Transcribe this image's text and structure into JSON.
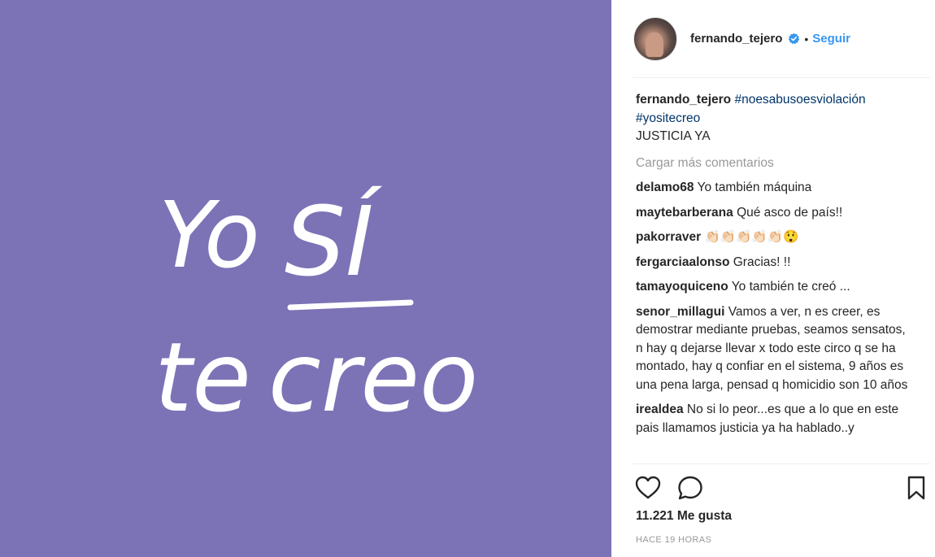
{
  "post_image": {
    "background_color": "#7b73b6",
    "line1_word1": "Yo",
    "line1_word2": "SÍ",
    "line2_word1": "te",
    "line2_word2": "creo"
  },
  "header": {
    "username": "fernando_tejero",
    "verified_icon": "verified-badge-icon",
    "separator": "•",
    "follow_label": "Seguir"
  },
  "caption": {
    "username": "fernando_tejero",
    "hashtag1": "#noesabusoesviolación",
    "hashtag2": "#yositecreo",
    "text": "JUSTICIA YA"
  },
  "load_more_label": "Cargar más comentarios",
  "comments": [
    {
      "user": "delamo68",
      "text": "Yo también máquina"
    },
    {
      "user": "maytebarberana",
      "text": "Qué asco de país!!"
    },
    {
      "user": "pakorraver",
      "text": "👏🏻👏🏻👏🏻👏🏻👏🏻😲"
    },
    {
      "user": "fergarciaalonso",
      "text": "Gracias! !!"
    },
    {
      "user": "tamayoquiceno",
      "text": "Yo también te creó ..."
    },
    {
      "user": "senor_millagui",
      "text": "Vamos a ver, n es creer, es demostrar mediante pruebas, seamos sensatos, n hay q dejarse llevar x todo este circo q se ha montado, hay q confiar en el sistema, 9 años es una pena larga, pensad q homicidio son 10 años"
    },
    {
      "user": "irealdea",
      "text": "No si lo peor...es que a lo que en este pais llamamos justicia ya ha hablado..y"
    }
  ],
  "actions": {
    "like_icon": "heart-icon",
    "comment_icon": "comment-bubble-icon",
    "save_icon": "bookmark-icon"
  },
  "likes_label": "11.221 Me gusta",
  "timestamp": "HACE 19 HORAS",
  "colors": {
    "accent": "#3897f0",
    "hashtag": "#003569",
    "muted": "#999999"
  }
}
